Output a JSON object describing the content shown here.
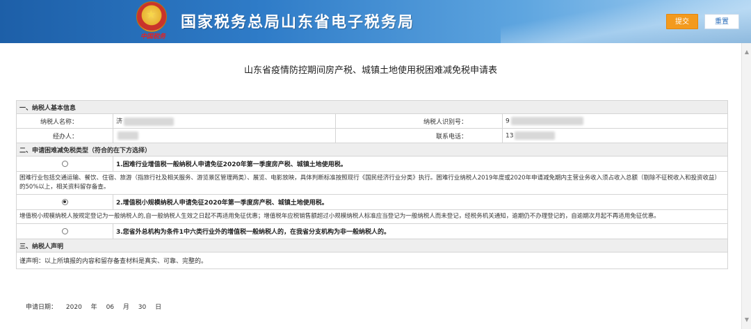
{
  "header": {
    "title": "国家税务总局山东省电子税务局",
    "emblem_caption": "中国税务",
    "submit_label": "提交",
    "reset_label": "重置"
  },
  "form": {
    "title": "山东省疫情防控期间房产税、城镇土地使用税困难减免税申请表",
    "section1": {
      "title": "一、纳税人基本信息",
      "taxpayer_name_label": "纳税人名称：",
      "taxpayer_name_value": "济",
      "taxpayer_id_label": "纳税人识别号：",
      "taxpayer_id_value": "9",
      "agent_label": "经办人：",
      "agent_value": "",
      "phone_label": "联系电话：",
      "phone_value": "13"
    },
    "section2": {
      "title": "二、申请困难减免税类型（符合的在下方选择）",
      "options": [
        {
          "label": "1.困难行业增值税一般纳税人申请免征2020年第一季度房产税、城镇土地使用税。",
          "description": "困难行业包括交通运输、餐饮、住宿、旅游（指旅行社及相关服务、游览景区管理两类）、展览、电影放映，具体判断标准按照现行《国民经济行业分类》执行。困难行业纳税人2019年度或2020年申请减免期内主营业务收入须占收入总额（剔除不征税收入和投资收益）的50%以上，相关资料留存备查。",
          "selected": false
        },
        {
          "label": "2.增值税小规模纳税人申请免征2020年第一季度房产税、城镇土地使用税。",
          "description": "增值税小规模纳税人按规定登记为一般纳税人的,自一般纳税人生效之日起不再适用免征优惠；增值税年应税销售额超过小规模纳税人标准应当登记为一般纳税人而未登记，经税务机关通知，逾期仍不办理登记的，自逾期次月起不再适用免征优惠。",
          "selected": true
        },
        {
          "label": "3.您省外总机构为条件1中六类行业外的增值税一般纳税人的，在我省分支机构为非一般纳税人的。",
          "description": "",
          "selected": false
        }
      ]
    },
    "section3": {
      "title": "三、纳税人声明",
      "declaration": "谨声明：以上所填报的内容和留存备查材料是真实、可靠、完整的。"
    },
    "apply_date": {
      "label": "申请日期：",
      "year": "2020",
      "year_unit": "年",
      "month": "06",
      "month_unit": "月",
      "day": "30",
      "day_unit": "日"
    }
  },
  "colors": {
    "header_blue": "#2f7cc8",
    "submit_orange": "#f39a1e",
    "section_gray": "#eeeeee",
    "border": "#d4d4d4"
  }
}
